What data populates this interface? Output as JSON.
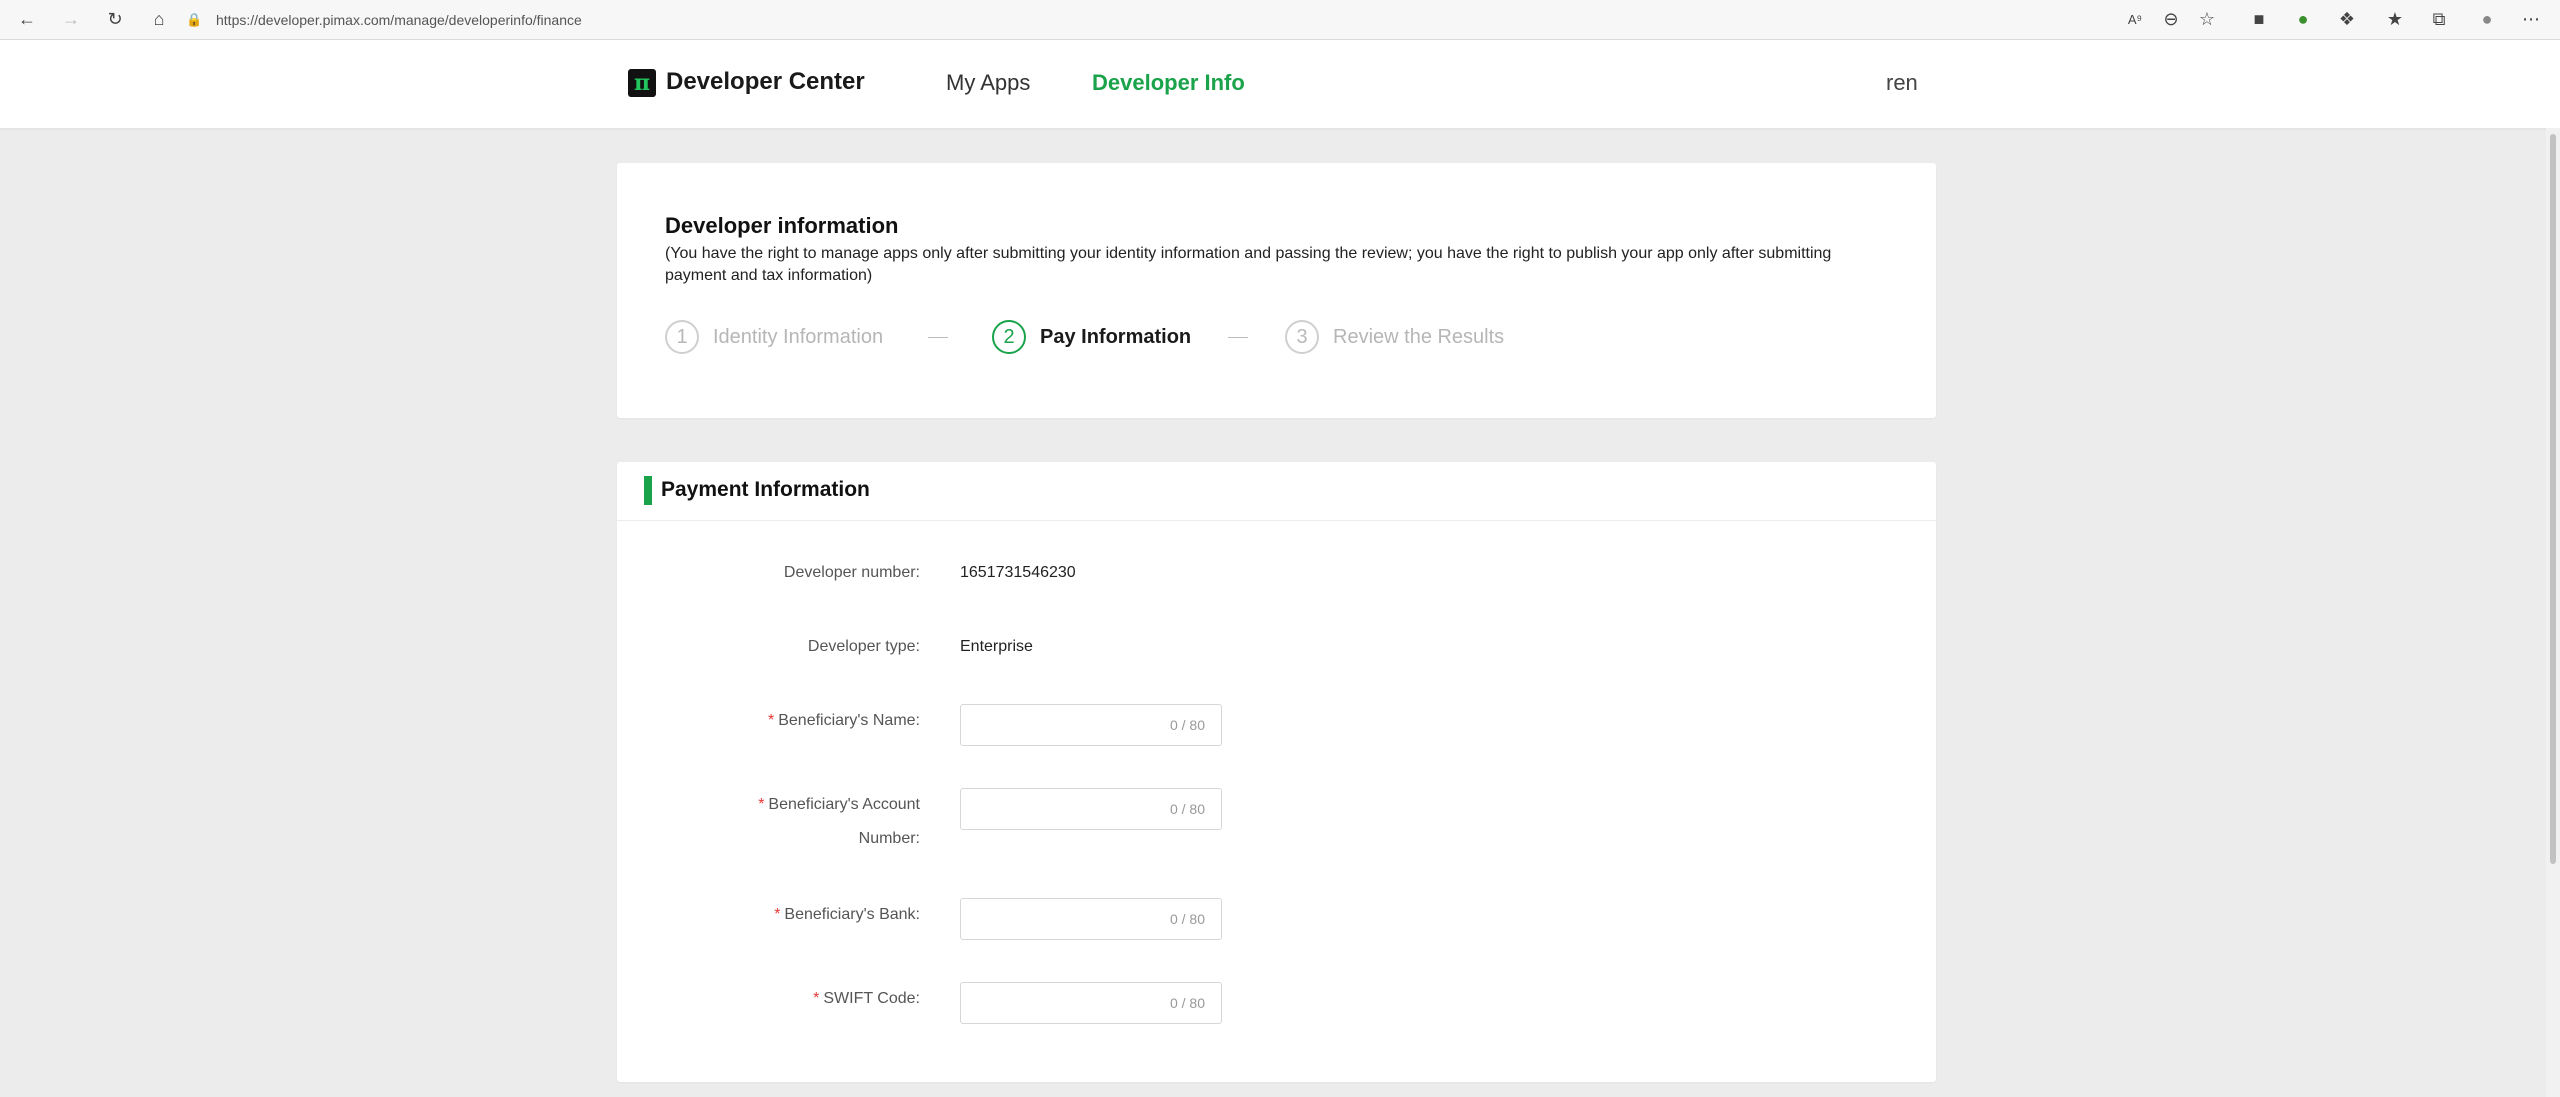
{
  "browser": {
    "url": "https://developer.pimax.com/manage/developerinfo/finance"
  },
  "header": {
    "logo_glyph": "π",
    "brand": "Developer Center",
    "nav": [
      {
        "label": "My Apps",
        "active": false
      },
      {
        "label": "Developer Info",
        "active": true
      }
    ],
    "user": "ren"
  },
  "intro": {
    "title": "Developer information",
    "description": "(You have the right to manage apps only after submitting your identity information and passing the review; you have the right to publish your app only after submitting payment and tax information)",
    "steps": [
      {
        "num": "1",
        "label": "Identity Information",
        "state": "done"
      },
      {
        "num": "2",
        "label": "Pay Information",
        "state": "active"
      },
      {
        "num": "3",
        "label": "Review the Results",
        "state": "pending"
      }
    ],
    "separator": "—"
  },
  "payment": {
    "title": "Payment Information",
    "developer_number_label": "Developer number",
    "developer_number": "1651731546230",
    "developer_type_label": "Developer type",
    "developer_type": "Enterprise",
    "fields": [
      {
        "label": "Beneficiary's Name",
        "value": "",
        "counter": "0 / 80",
        "required": "*"
      },
      {
        "label_line1": "Beneficiary's Account",
        "label_line2": "Number",
        "value": "",
        "counter": "0 / 80",
        "required": "*"
      },
      {
        "label": "Beneficiary's Bank",
        "value": "",
        "counter": "0 / 80",
        "required": "*"
      },
      {
        "label": "SWIFT Code",
        "value": "",
        "counter": "0 / 80",
        "required": "*"
      }
    ],
    "colon": ":"
  },
  "colors": {
    "accent": "#1aa34a",
    "required": "#e53935"
  }
}
